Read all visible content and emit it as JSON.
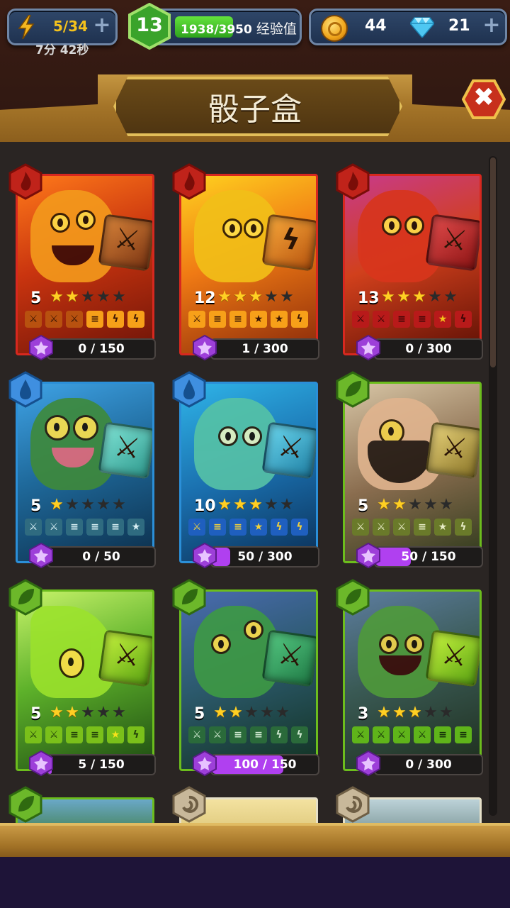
{
  "status": {
    "energy": "5/34",
    "timer_min": "7分",
    "timer_sec": "42秒",
    "level": "13",
    "xp": "1938/3950",
    "xp_fraction": 0.49,
    "xp_label": "经验值",
    "coins": "44",
    "gems": "21"
  },
  "screen": {
    "title": "骰子盒"
  },
  "cards": [
    {
      "element": "fire",
      "level": "5",
      "stars": 2,
      "progress": "0 / 150",
      "fill": 0.0
    },
    {
      "element": "fire",
      "level": "12",
      "stars": 3,
      "progress": "1 / 300",
      "fill": 0.003
    },
    {
      "element": "fire",
      "level": "13",
      "stars": 3,
      "progress": "0 / 300",
      "fill": 0.0
    },
    {
      "element": "water",
      "level": "5",
      "stars": 1,
      "progress": "0 / 50",
      "fill": 0.0
    },
    {
      "element": "water",
      "level": "10",
      "stars": 3,
      "progress": "50 / 300",
      "fill": 0.17
    },
    {
      "element": "nature",
      "level": "5",
      "stars": 2,
      "progress": "50 / 150",
      "fill": 0.33
    },
    {
      "element": "nature",
      "level": "5",
      "stars": 2,
      "progress": "5 / 150",
      "fill": 0.03
    },
    {
      "element": "nature",
      "level": "5",
      "stars": 2,
      "progress": "100 / 150",
      "fill": 0.67
    },
    {
      "element": "nature",
      "level": "3",
      "stars": 3,
      "progress": "0 / 300",
      "fill": 0.0
    }
  ],
  "colors": {
    "fire": "#d7281f",
    "water": "#2b8fd8",
    "nature": "#6cbd1d",
    "progress_fill": "#b040f0"
  },
  "icons": {
    "energy": "lightning-icon",
    "coin": "coin-icon",
    "gem": "diamond-icon",
    "close": "close-icon"
  }
}
